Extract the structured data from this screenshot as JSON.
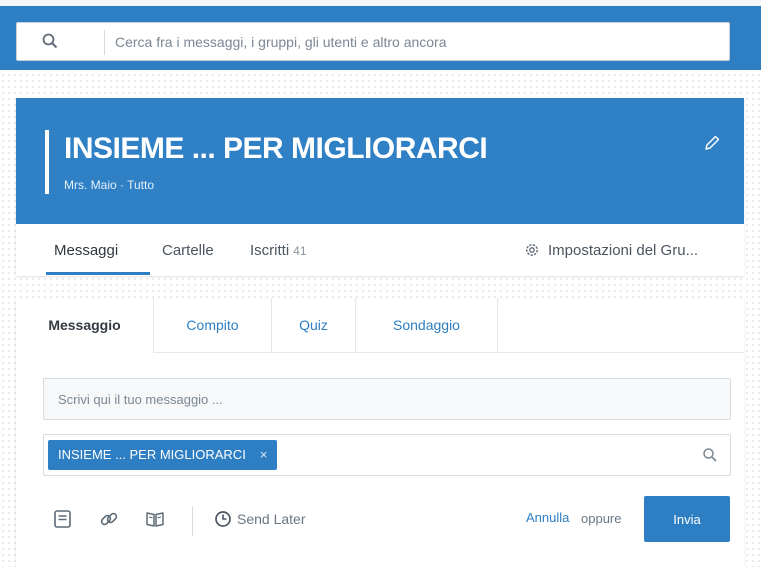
{
  "search": {
    "placeholder": "Cerca fra i messaggi, i gruppi, gli utenti e altro ancora",
    "icon": "search-icon"
  },
  "group": {
    "title": "INSIEME ... PER MIGLIORARCI",
    "subtitle": "Mrs. Maio · Tutto",
    "edit_icon": "pencil-icon",
    "tabs": [
      {
        "label": "Messaggi",
        "active": true
      },
      {
        "label": "Cartelle"
      },
      {
        "label": "Iscritti",
        "count": "41"
      }
    ],
    "settings_label": "Impostazioni del Gru...",
    "settings_icon": "gear-icon"
  },
  "composer": {
    "tabs": [
      {
        "label": "Messaggio",
        "active": true
      },
      {
        "label": "Compito"
      },
      {
        "label": "Quiz"
      },
      {
        "label": "Sondaggio"
      }
    ],
    "message_placeholder": "Scrivi qui il tuo messaggio ...",
    "recipient_chip": "INSIEME ... PER MIGLIORARCI",
    "chip_remove": "×",
    "send_later": "Send Later",
    "cancel": "Annulla",
    "or": "oppure",
    "send": "Invia"
  },
  "colors": {
    "brand": "#2d7ec3",
    "header": "#2f80c4"
  }
}
